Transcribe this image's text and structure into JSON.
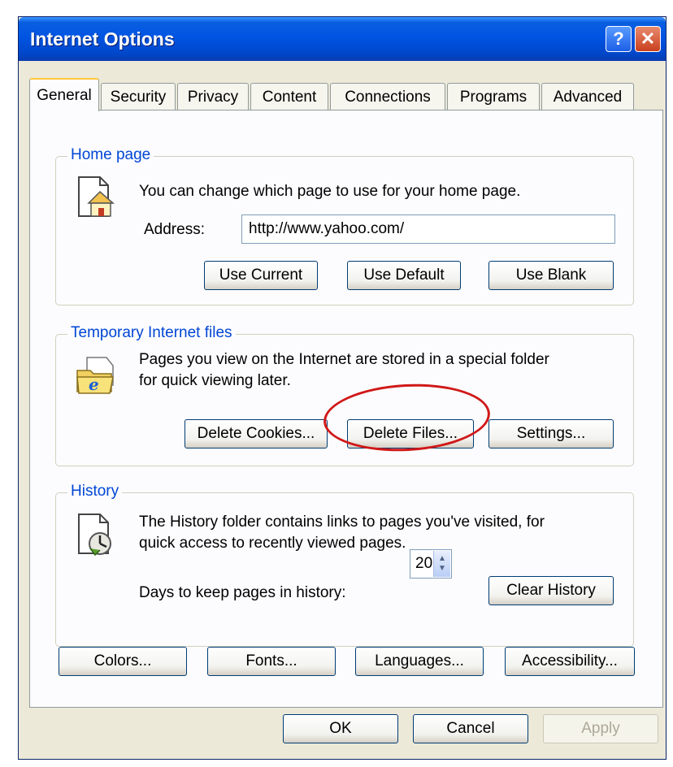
{
  "window": {
    "title": "Internet Options"
  },
  "tabs": [
    {
      "label": "General",
      "active": true
    },
    {
      "label": "Security"
    },
    {
      "label": "Privacy"
    },
    {
      "label": "Content"
    },
    {
      "label": "Connections"
    },
    {
      "label": "Programs"
    },
    {
      "label": "Advanced"
    }
  ],
  "home_page": {
    "legend": "Home page",
    "description": "You can change which page to use for your home page.",
    "address_label": "Address:",
    "address_value": "http://www.yahoo.com/",
    "use_current": "Use Current",
    "use_default": "Use Default",
    "use_blank": "Use Blank"
  },
  "temp_files": {
    "legend": "Temporary Internet files",
    "description_line1": "Pages you view on the Internet are stored in a special folder",
    "description_line2": "for quick viewing later.",
    "delete_cookies": "Delete Cookies...",
    "delete_files": "Delete Files...",
    "settings": "Settings..."
  },
  "history": {
    "legend": "History",
    "description_line1": "The History folder contains links to pages you've visited, for",
    "description_line2": "quick access to recently viewed pages.",
    "days_label": "Days to keep pages in history:",
    "days_value": "20",
    "clear_history": "Clear History"
  },
  "bottom_buttons": {
    "colors": "Colors...",
    "fonts": "Fonts...",
    "languages": "Languages...",
    "accessibility": "Accessibility..."
  },
  "dialog_buttons": {
    "ok": "OK",
    "cancel": "Cancel",
    "apply": "Apply"
  },
  "colors": {
    "titlebar": "#0054e3",
    "dialog_bg": "#ece9d8",
    "legend": "#0046d5",
    "highlight_circle": "#d01818"
  },
  "icons": {
    "home": "home-page-icon",
    "temp_files": "ie-folder-icon",
    "history": "history-clock-icon"
  }
}
